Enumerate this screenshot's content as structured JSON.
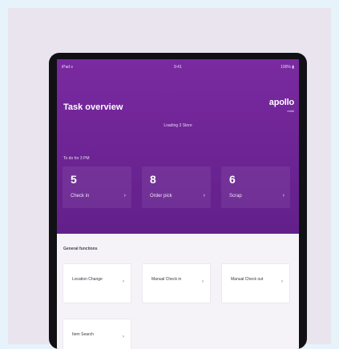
{
  "status_bar": {
    "left": "iPad ≡",
    "center": "9:41",
    "right": "100% ▮"
  },
  "header": {
    "title": "Task overview",
    "logo": "apollo",
    "logo_sub": "retail",
    "subtitle": "Loading 3 Store"
  },
  "top_section": {
    "label": "To do for 3 PM",
    "tiles": [
      {
        "count": "5",
        "label": "Check in",
        "chevron": "›"
      },
      {
        "count": "8",
        "label": "Order pick",
        "chevron": "›"
      },
      {
        "count": "6",
        "label": "Scrap",
        "chevron": "›"
      }
    ]
  },
  "bottom_section": {
    "label": "General functions",
    "tiles": [
      {
        "label": "Location Change",
        "chevron": "›"
      },
      {
        "label": "Manual Check in",
        "chevron": "›"
      },
      {
        "label": "Manual Check out",
        "chevron": "›"
      },
      {
        "label": "Item Search",
        "chevron": "›"
      }
    ]
  },
  "colors": {
    "background": "#e6f3fa",
    "card": "#e9e4ee",
    "brand_purple": "#6f2596"
  }
}
